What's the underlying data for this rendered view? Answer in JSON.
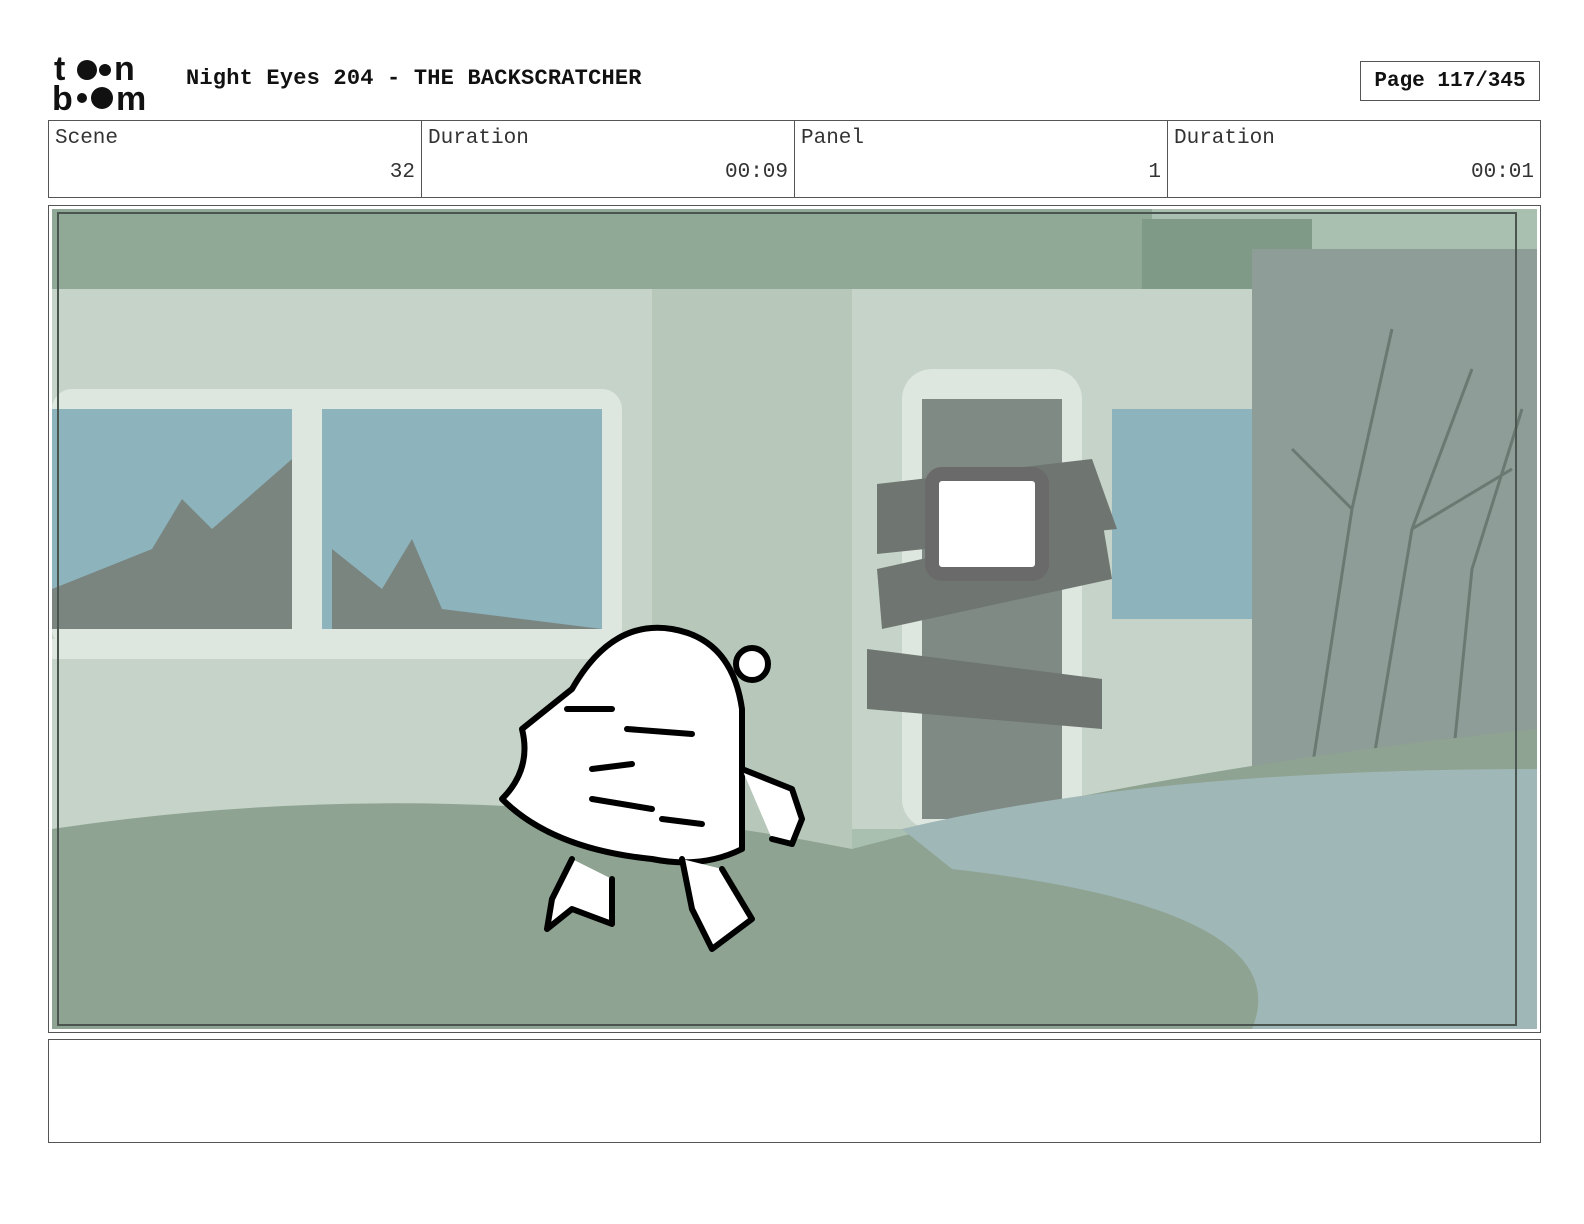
{
  "header": {
    "logo_text_top": "toon",
    "logo_text_bottom": "boom",
    "title": "Night Eyes 204 - THE BACKSCRATCHER",
    "page_label": "Page 117/345"
  },
  "info": {
    "scene_label": "Scene",
    "scene_value": "32",
    "scene_duration_label": "Duration",
    "scene_duration_value": "00:09",
    "panel_label": "Panel",
    "panel_value": "1",
    "panel_duration_label": "Duration",
    "panel_duration_value": "00:01"
  },
  "notes": {
    "text": ""
  },
  "colors": {
    "sky": "#9fb8a8",
    "wall": "#c9d6cc",
    "glass": "#8fb5bf",
    "ground": "#8fa595",
    "wood": "#6f7570"
  }
}
